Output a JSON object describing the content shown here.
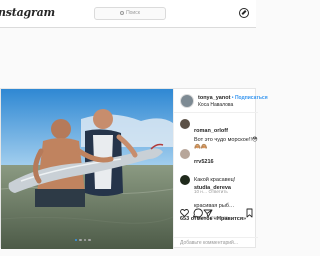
{
  "header": {
    "logo": "Instagram",
    "search_placeholder": "Поиск"
  },
  "post": {
    "author": {
      "username": "tonya_yanot",
      "follow_label": "Подписаться",
      "location": "Коса Навалова"
    },
    "comments": [
      {
        "username": "roman_orloff",
        "text": "Вот это чудо морское!!😳🙈🙈",
        "meta": ""
      },
      {
        "username": "rrv5216",
        "text": "Какой красавец!",
        "meta": "10 н…  Ответить"
      },
      {
        "username": "studia_dereva",
        "text": "красивая рыб…",
        "meta": "19 нед.  Ответить"
      }
    ],
    "likes_text": "653 отметок «Нравится»",
    "add_comment_placeholder": "Добавьте комментарий..."
  },
  "colors": {
    "accent": "#3897f0",
    "border": "#dbdbdb",
    "muted": "#999999"
  },
  "icons": [
    "search-icon",
    "compass-icon",
    "heart-icon",
    "comment-icon",
    "share-icon",
    "bookmark-icon"
  ]
}
